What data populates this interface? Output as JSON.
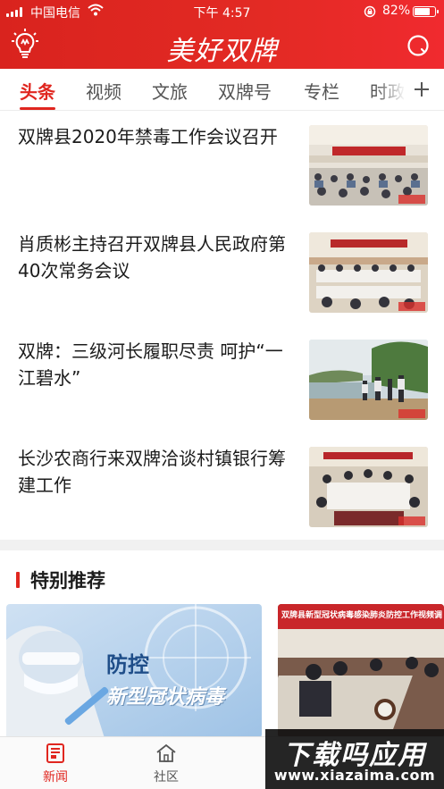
{
  "status_bar": {
    "carrier": "中国电信",
    "time": "下午 4:57",
    "battery_percent": "82%",
    "battery_level": 0.82
  },
  "header": {
    "app_title": "美好双牌",
    "logo_icon": "lightbulb-logo-icon",
    "search_icon": "search-icon",
    "color_accent": "#e0261f"
  },
  "tabs": {
    "items": [
      "头条",
      "视频",
      "文旅",
      "双牌号",
      "专栏",
      "时政"
    ],
    "active_index": 0,
    "add_icon": "plus-icon"
  },
  "news": [
    {
      "title": "双牌县2020年禁毒工作会议召开",
      "thumb_icon": "meeting-hall-photo"
    },
    {
      "title": "肖质彬主持召开双牌县人民政府第40次常务会议",
      "thumb_icon": "meeting-room-photo"
    },
    {
      "title": "双牌：三级河长履职尽责 呵护“一江碧水”",
      "thumb_icon": "river-inspection-photo"
    },
    {
      "title": "长沙农商行来双牌洽谈村镇银行筹建工作",
      "thumb_icon": "conference-table-photo"
    }
  ],
  "special": {
    "section_title": "特别推荐",
    "cards": [
      {
        "caption_line1": "防控",
        "caption_line2": "新型冠状病毒",
        "icon": "lab-researcher-photo"
      },
      {
        "banner_text": "双牌县新型冠状病毒感染肺炎防控工作视频调度",
        "icon": "meeting-photo"
      }
    ]
  },
  "tabbar": {
    "items": [
      {
        "label": "新闻",
        "icon": "news-icon"
      },
      {
        "label": "社区",
        "icon": "home-icon"
      }
    ],
    "active_index": 0
  },
  "watermark": {
    "line1": "下载吗应用",
    "line2": "www.xiazaima.com"
  }
}
